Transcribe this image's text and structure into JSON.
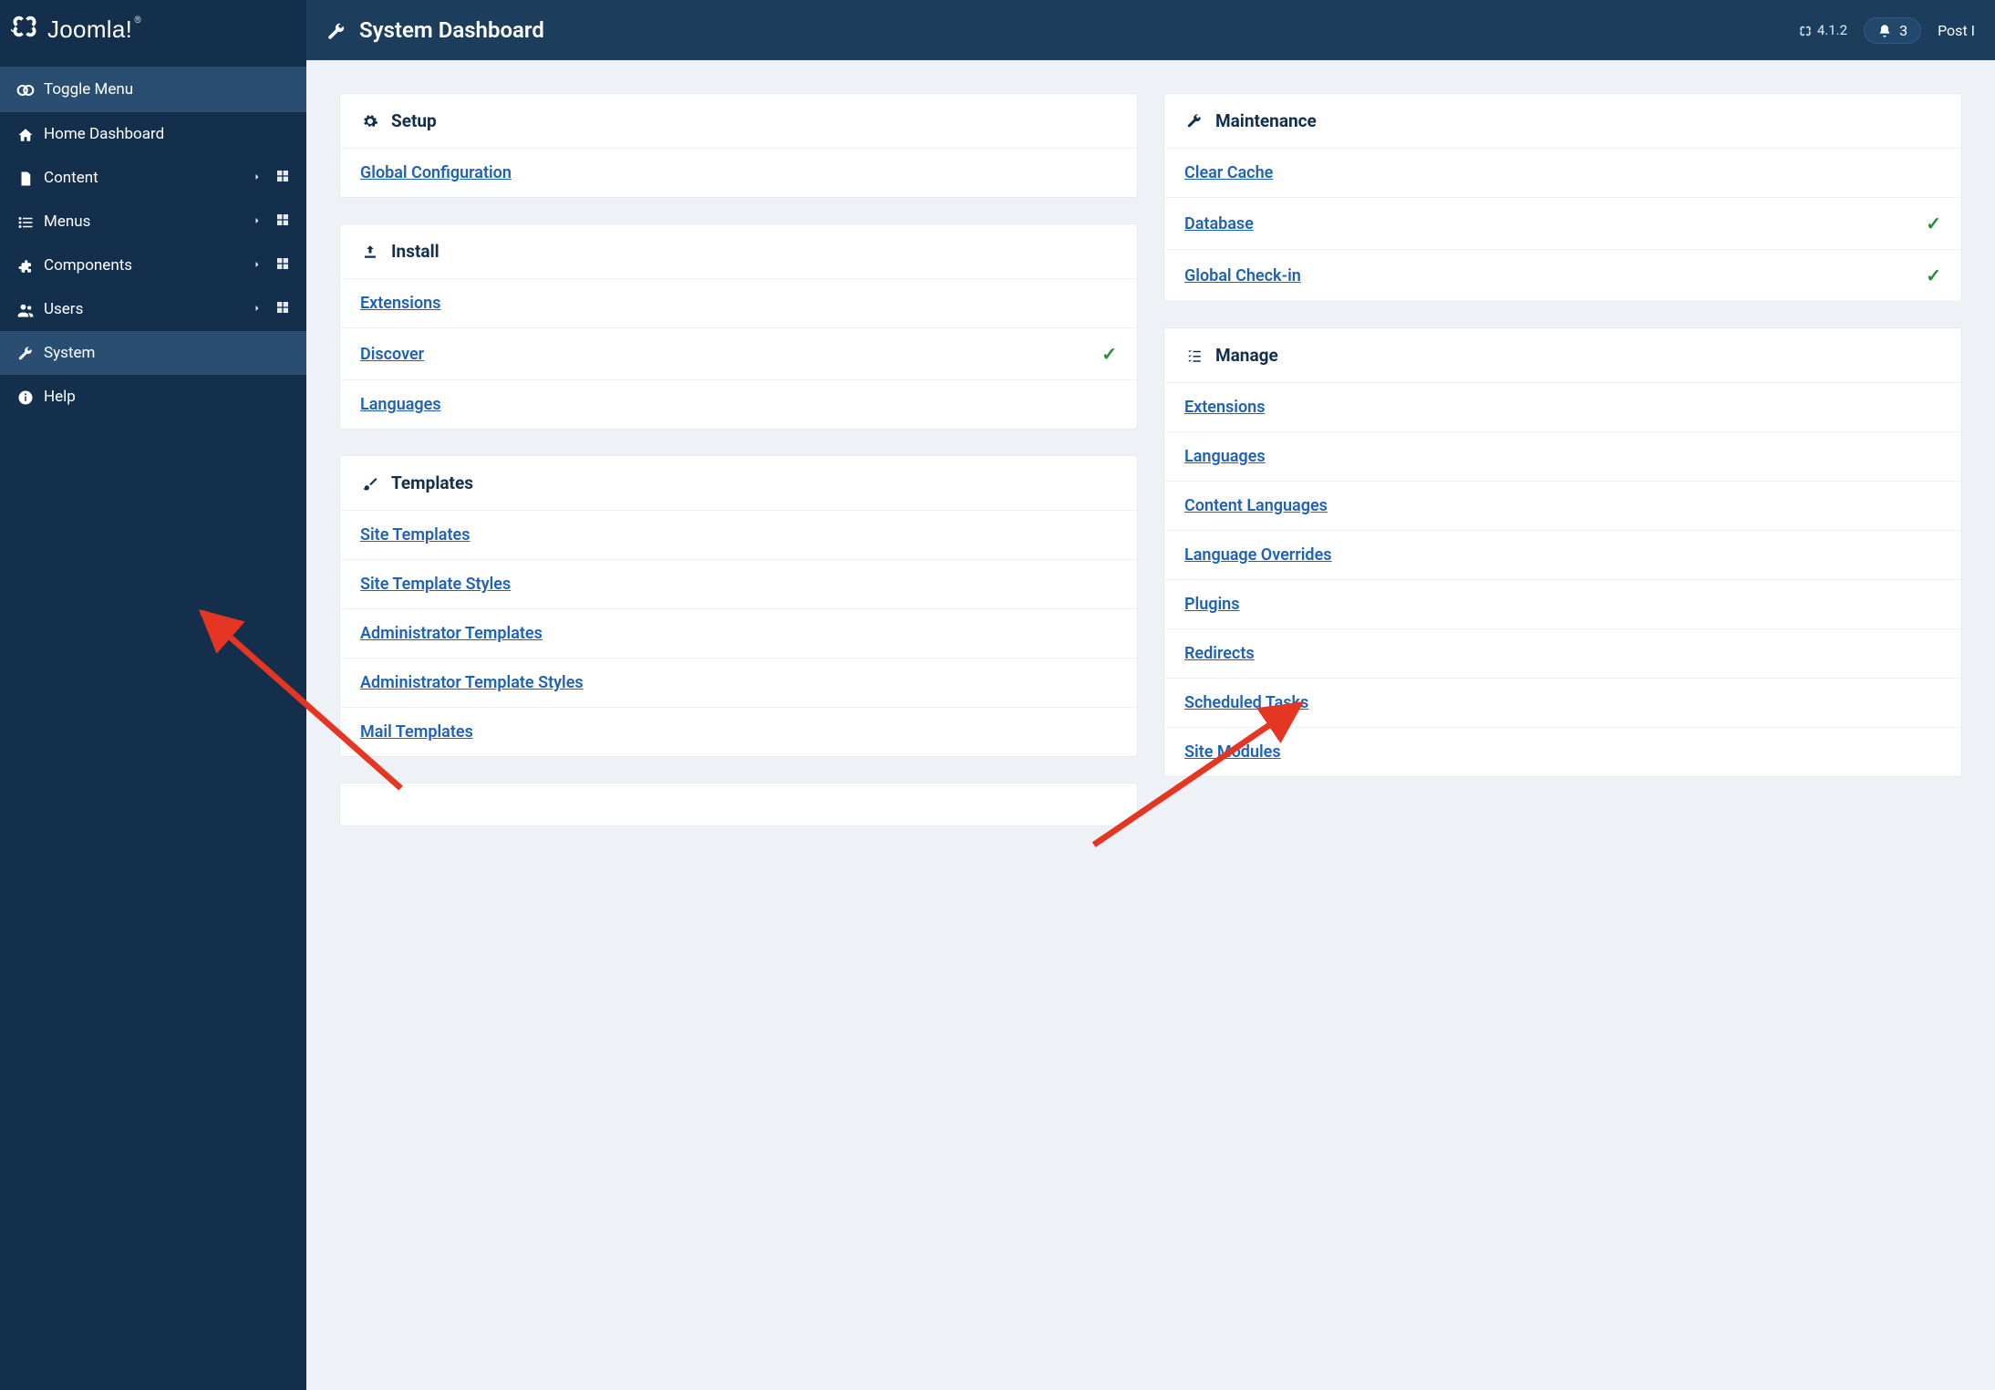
{
  "brand": {
    "name": "Joomla!",
    "registered": "®"
  },
  "sidebar": {
    "toggle_label": "Toggle Menu",
    "items": [
      {
        "icon": "home",
        "label": "Home Dashboard",
        "has_children": false,
        "has_dashboard": false
      },
      {
        "icon": "file",
        "label": "Content",
        "has_children": true,
        "has_dashboard": true
      },
      {
        "icon": "list",
        "label": "Menus",
        "has_children": true,
        "has_dashboard": true
      },
      {
        "icon": "puzzle",
        "label": "Components",
        "has_children": true,
        "has_dashboard": true
      },
      {
        "icon": "users",
        "label": "Users",
        "has_children": true,
        "has_dashboard": true
      },
      {
        "icon": "wrench",
        "label": "System",
        "has_children": false,
        "has_dashboard": false,
        "active": true
      },
      {
        "icon": "info",
        "label": "Help",
        "has_children": false,
        "has_dashboard": false
      }
    ]
  },
  "header": {
    "title": "System Dashboard",
    "version": "4.1.2",
    "notifications": "3",
    "post_label": "Post I"
  },
  "panels": {
    "col1": [
      {
        "icon": "cog",
        "title": "Setup",
        "links": [
          {
            "label": "Global Configuration"
          }
        ]
      },
      {
        "icon": "upload",
        "title": "Install",
        "links": [
          {
            "label": "Extensions"
          },
          {
            "label": "Discover",
            "check": true
          },
          {
            "label": "Languages"
          }
        ]
      },
      {
        "icon": "brush",
        "title": "Templates",
        "links": [
          {
            "label": "Site Templates"
          },
          {
            "label": "Site Template Styles"
          },
          {
            "label": "Administrator Templates"
          },
          {
            "label": "Administrator Template Styles"
          },
          {
            "label": "Mail Templates"
          }
        ]
      },
      {
        "icon": "",
        "title": "",
        "links": []
      }
    ],
    "col2": [
      {
        "icon": "wrench",
        "title": "Maintenance",
        "links": [
          {
            "label": "Clear Cache"
          },
          {
            "label": "Database",
            "check": true
          },
          {
            "label": "Global Check-in",
            "check": true
          }
        ]
      },
      {
        "icon": "listcheck",
        "title": "Manage",
        "links": [
          {
            "label": "Extensions"
          },
          {
            "label": "Languages"
          },
          {
            "label": "Content Languages"
          },
          {
            "label": "Language Overrides"
          },
          {
            "label": "Plugins"
          },
          {
            "label": "Redirects"
          },
          {
            "label": "Scheduled Tasks"
          },
          {
            "label": "Site Modules"
          }
        ]
      }
    ]
  }
}
